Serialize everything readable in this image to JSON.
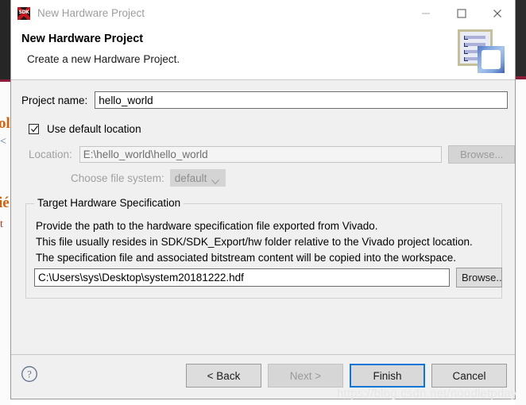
{
  "window": {
    "app_icon": "sdk-icon",
    "app_icon_text": "SDK",
    "title": "New Hardware Project",
    "minimize_label": "minimize-icon",
    "maximize_label": "maximize-icon",
    "close_label": "close-icon"
  },
  "header": {
    "title": "New Hardware Project",
    "subtitle": "Create a new Hardware Project.",
    "artwork": "hardware-project-wizard-icon"
  },
  "form": {
    "project_name_label": "Project name:",
    "project_name_value": "hello_world",
    "project_name_placeholder": "",
    "use_default_location_label": "Use default location",
    "use_default_location_checked": true,
    "location_label": "Location:",
    "location_value": "E:\\hello_world\\hello_world",
    "location_browse_label": "Browse...",
    "location_enabled": false,
    "file_system_label": "Choose file system:",
    "file_system_value": "default",
    "file_system_options": [
      "default"
    ],
    "file_system_enabled": false
  },
  "target_group": {
    "legend": "Target Hardware Specification",
    "lines": [
      "Provide the path to the hardware specification file exported from Vivado.",
      "This file usually resides in SDK/SDK_Export/hw folder relative to the Vivado project location.",
      "The specification file and associated bitstream content will be copied into the workspace."
    ],
    "hdf_path_value": "C:\\Users\\sys\\Desktop\\system20181222.hdf",
    "hdf_path_placeholder": "",
    "browse_label": "Browse.."
  },
  "footer": {
    "help_icon": "help-question-icon",
    "back_label": "< Back",
    "next_label": "Next >",
    "finish_label": "Finish",
    "cancel_label": "Cancel",
    "next_enabled": false,
    "finish_is_default": true
  },
  "overlay": {
    "watermark": "https://blog.csdn.net/noodletpday"
  },
  "backdrop": {
    "left_fragments": [
      "ol",
      "<",
      "ié",
      "t"
    ]
  },
  "colors": {
    "accent_blue": "#0a76d8",
    "dialog_bg": "#f0f0f0",
    "title_text": "#9d9d9d",
    "disabled_text": "#a0a0a0",
    "sdk_red": "#c4161c"
  }
}
